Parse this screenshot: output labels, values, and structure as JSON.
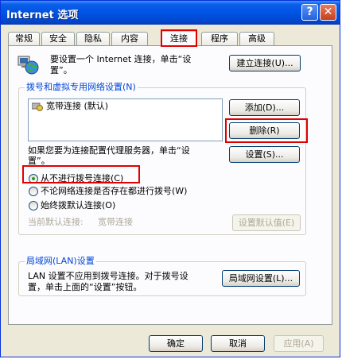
{
  "window": {
    "title": "Internet 选项",
    "help": "?",
    "close": "✕"
  },
  "tabs": [
    {
      "label": "常规"
    },
    {
      "label": "安全"
    },
    {
      "label": "隐私"
    },
    {
      "label": "内容"
    },
    {
      "label": "连接",
      "active": true
    },
    {
      "label": "程序"
    },
    {
      "label": "高级"
    }
  ],
  "setup": {
    "text_line1": "要设置一个 Internet 连接，单击“设",
    "text_line2": "置”。",
    "button": "建立连接(U)..."
  },
  "dialup": {
    "legend": "拨号和虚拟专用网络设置(N)",
    "items": [
      "宽带连接 (默认)"
    ],
    "add": "添加(D)...",
    "remove": "删除(R)",
    "proxy_line1": "如果您要为连接配置代理服务器，单击“设",
    "proxy_line2": "置”。",
    "settings": "设置(S)...",
    "options": [
      {
        "label": "从不进行拨号连接(C)",
        "checked": true
      },
      {
        "label": "不论网络连接是否存在都进行拨号(W)",
        "checked": false
      },
      {
        "label": "始终拨默认连接(O)",
        "checked": false
      }
    ],
    "current_label": "当前默认连接:",
    "current_value": "宽带连接",
    "set_default": "设置默认值(E)"
  },
  "lan": {
    "legend": "局域网(LAN)设置",
    "text_line1": "LAN 设置不应用到拨号连接。对于拨号设",
    "text_line2": "置，单击上面的“设置”按钮。",
    "button": "局域网设置(L)..."
  },
  "footer": {
    "ok": "确定",
    "cancel": "取消",
    "apply": "应用(A)"
  }
}
